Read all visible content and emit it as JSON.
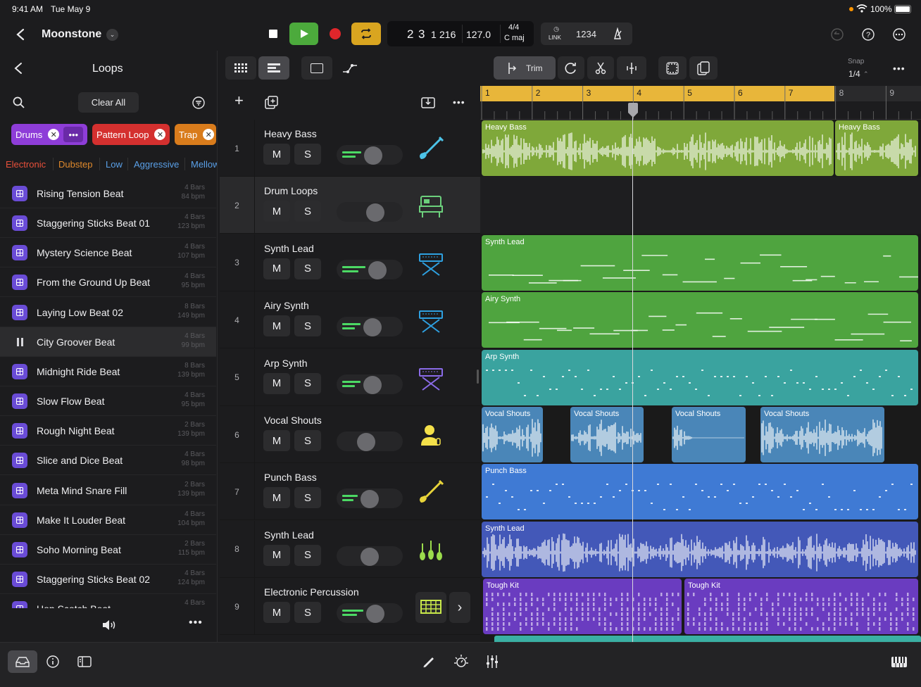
{
  "status": {
    "time": "9:41 AM",
    "date": "Tue May 9",
    "battery": "100%"
  },
  "project": {
    "name": "Moonstone"
  },
  "transport": {
    "position_bar": "2",
    "position_beat": "3",
    "position_div": "1",
    "position_tick": "216",
    "tempo": "127.0",
    "time_sig": "4/4",
    "key": "C maj",
    "link_label": "LINK",
    "countin_label": "1234"
  },
  "toolbar": {
    "trim_label": "Trim",
    "snap_label": "Snap",
    "snap_value": "1/4"
  },
  "sidebar": {
    "title": "Loops",
    "clear_all": "Clear All",
    "filter_chips": [
      {
        "label": "Drums",
        "color": "#8e3dd8"
      },
      {
        "label": "Pattern Loop",
        "color": "#e0353a"
      },
      {
        "label": "Trap",
        "color": "#e0831f"
      }
    ],
    "tags": [
      {
        "label": "Electronic",
        "color": "#e8503a"
      },
      {
        "label": "Dubstep",
        "color": "#e08a2c"
      },
      {
        "label": "Low",
        "color": "#5aa0e8"
      },
      {
        "label": "Aggressive",
        "color": "#5aa0e8"
      },
      {
        "label": "Mellow",
        "color": "#5aa0e8"
      }
    ],
    "loops": [
      {
        "name": "Rising Tension Beat",
        "bars": "4 Bars",
        "bpm": "84 bpm"
      },
      {
        "name": "Staggering Sticks Beat 01",
        "bars": "4 Bars",
        "bpm": "123 bpm"
      },
      {
        "name": "Mystery Science Beat",
        "bars": "4 Bars",
        "bpm": "107 bpm"
      },
      {
        "name": "From the Ground Up Beat",
        "bars": "4 Bars",
        "bpm": "95 bpm"
      },
      {
        "name": "Laying Low Beat 02",
        "bars": "8 Bars",
        "bpm": "149 bpm"
      },
      {
        "name": "City Groover Beat",
        "bars": "4 Bars",
        "bpm": "99 bpm"
      },
      {
        "name": "Midnight Ride Beat",
        "bars": "8 Bars",
        "bpm": "139 bpm"
      },
      {
        "name": "Slow Flow Beat",
        "bars": "4 Bars",
        "bpm": "95 bpm"
      },
      {
        "name": "Rough Night Beat",
        "bars": "2 Bars",
        "bpm": "139 bpm"
      },
      {
        "name": "Slice and Dice Beat",
        "bars": "4 Bars",
        "bpm": "98 bpm"
      },
      {
        "name": "Meta Mind Snare Fill",
        "bars": "2 Bars",
        "bpm": "139 bpm"
      },
      {
        "name": "Make It Louder Beat",
        "bars": "4 Bars",
        "bpm": "104 bpm"
      },
      {
        "name": "Soho Morning Beat",
        "bars": "2 Bars",
        "bpm": "115 bpm"
      },
      {
        "name": "Staggering Sticks Beat 02",
        "bars": "4 Bars",
        "bpm": "124 bpm"
      },
      {
        "name": "Hop Scotch Beat",
        "bars": "4 Bars",
        "bpm": ""
      }
    ]
  },
  "tracks": [
    {
      "num": "1",
      "name": "Heavy Bass",
      "mute": "M",
      "solo": "S",
      "volume": 0.55,
      "instrument": "bass-guitar-icon"
    },
    {
      "num": "2",
      "name": "Drum Loops",
      "mute": "M",
      "solo": "S",
      "volume": 0.6,
      "instrument": "drum-machine-icon"
    },
    {
      "num": "3",
      "name": "Synth Lead",
      "mute": "M",
      "solo": "S",
      "volume": 0.65,
      "instrument": "keyboard-stand-icon"
    },
    {
      "num": "4",
      "name": "Airy Synth",
      "mute": "M",
      "solo": "S",
      "volume": 0.53,
      "instrument": "keyboard-stand-icon"
    },
    {
      "num": "5",
      "name": "Arp Synth",
      "mute": "M",
      "solo": "S",
      "volume": 0.53,
      "instrument": "keyboard-stand-icon"
    },
    {
      "num": "6",
      "name": "Vocal Shouts",
      "mute": "M",
      "solo": "S",
      "volume": 0.38,
      "instrument": "vocalist-icon"
    },
    {
      "num": "7",
      "name": "Punch Bass",
      "mute": "M",
      "solo": "S",
      "volume": 0.47,
      "instrument": "bass-guitar-icon"
    },
    {
      "num": "8",
      "name": "Synth Lead",
      "mute": "M",
      "solo": "S",
      "volume": 0.47,
      "instrument": "orchestra-icon"
    },
    {
      "num": "9",
      "name": "Electronic Percussion",
      "mute": "M",
      "solo": "S",
      "volume": 0.6,
      "instrument": "beat-sequencer-icon"
    }
  ],
  "ruler": {
    "bars": [
      "1",
      "2",
      "3",
      "4",
      "5",
      "6",
      "7",
      "8",
      "9"
    ]
  },
  "regions": [
    {
      "track": 0,
      "label": "Heavy Bass",
      "color": "#7fa83a"
    },
    {
      "track": 0,
      "label": "Heavy Bass",
      "color": "#7fa83a"
    },
    {
      "track": 2,
      "label": "Synth Lead",
      "color": "#4fa43f"
    },
    {
      "track": 3,
      "label": "Airy Synth",
      "color": "#4fa43f"
    },
    {
      "track": 4,
      "label": "Arp Synth",
      "color": "#3aa39f"
    },
    {
      "track": 5,
      "label": "Vocal Shouts",
      "color": "#4a86b8"
    },
    {
      "track": 5,
      "label": "Vocal Shouts",
      "color": "#4a86b8"
    },
    {
      "track": 5,
      "label": "Vocal Shouts",
      "color": "#4a86b8"
    },
    {
      "track": 5,
      "label": "Vocal Shouts",
      "color": "#4a86b8"
    },
    {
      "track": 6,
      "label": "Punch Bass",
      "color": "#3f7ad4"
    },
    {
      "track": 7,
      "label": "Synth Lead",
      "color": "#4358b8"
    },
    {
      "track": 8,
      "label": "Tough Kit",
      "color": "#6a3cc0"
    },
    {
      "track": 8,
      "label": "Tough Kit",
      "color": "#6a3cc0"
    }
  ]
}
